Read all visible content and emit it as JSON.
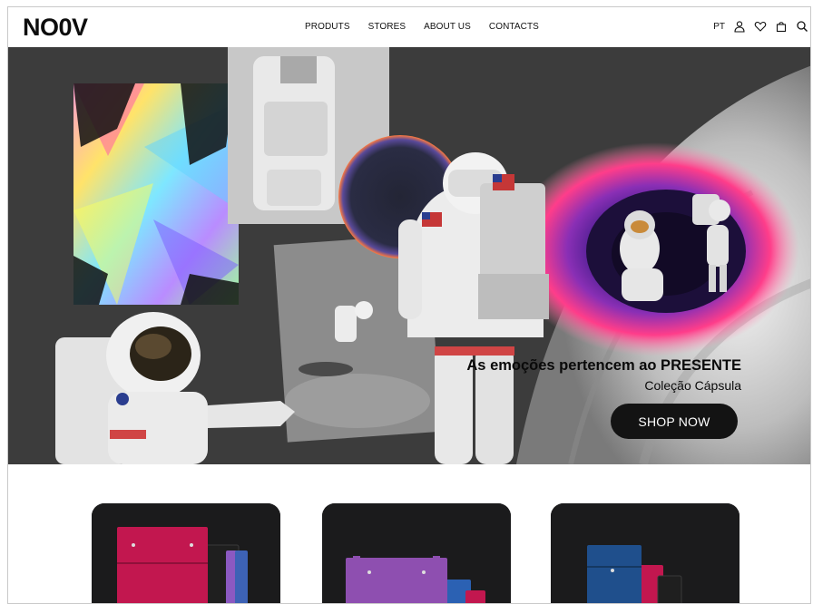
{
  "brand": {
    "logo": "NO0V"
  },
  "nav": {
    "items": [
      {
        "label": "PRODUTS"
      },
      {
        "label": "STORES"
      },
      {
        "label": "ABOUT US"
      },
      {
        "label": "CONTACTS"
      }
    ]
  },
  "utility": {
    "language": "PT",
    "icons": [
      "user-icon",
      "heart-icon",
      "bag-icon",
      "search-icon"
    ]
  },
  "hero": {
    "headline": "As emoções pertencem ao PRESENTE",
    "subheadline": "Coleção Cápsula",
    "cta_label": "SHOP NOW"
  },
  "products": {
    "cards": [
      {
        "accent": "#c2174f",
        "name": ""
      },
      {
        "accent": "#8e4fb0",
        "name": ""
      },
      {
        "accent": "#1f4f8c",
        "name": ""
      }
    ]
  },
  "colors": {
    "hero_bg": "#3c3c3c",
    "button_bg": "#131313",
    "portal_pink": "#ff3d8a",
    "portal_purple": "#6b2fb5"
  }
}
